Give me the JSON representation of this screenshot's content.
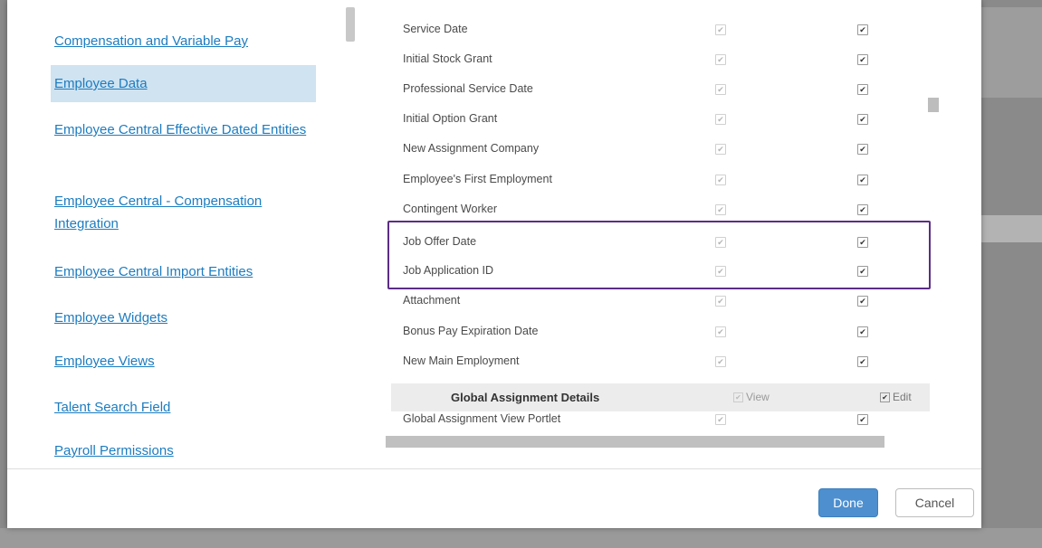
{
  "nav": {
    "items": [
      {
        "label": "Compensation and Variable Pay"
      },
      {
        "label": "Employee Data"
      },
      {
        "label": "Employee Central Effective Dated Entities"
      },
      {
        "label": "Employee Central - Compensation Integration"
      },
      {
        "label": "Employee Central Import Entities"
      },
      {
        "label": "Employee Widgets"
      },
      {
        "label": "Employee Views"
      },
      {
        "label": "Talent Search Field"
      },
      {
        "label": "Payroll Permissions"
      }
    ],
    "selected": "Employee Data"
  },
  "permissions": {
    "rows": [
      {
        "label": "Service Date",
        "view": true,
        "edit": true
      },
      {
        "label": "Initial Stock Grant",
        "view": true,
        "edit": true
      },
      {
        "label": "Professional Service Date",
        "view": true,
        "edit": true
      },
      {
        "label": "Initial Option Grant",
        "view": true,
        "edit": true
      },
      {
        "label": "New Assignment Company",
        "view": true,
        "edit": true
      },
      {
        "label": "Employee's First Employment",
        "view": true,
        "edit": true
      },
      {
        "label": "Contingent Worker",
        "view": true,
        "edit": true
      },
      {
        "label": "Job Offer Date",
        "view": true,
        "edit": true
      },
      {
        "label": "Job Application ID",
        "view": true,
        "edit": true
      },
      {
        "label": "Attachment",
        "view": true,
        "edit": true
      },
      {
        "label": "Bonus Pay Expiration Date",
        "view": true,
        "edit": true
      },
      {
        "label": "New Main Employment",
        "view": true,
        "edit": true
      }
    ],
    "group": {
      "title": "Global Assignment Details",
      "view_label": "View",
      "edit_label": "Edit"
    },
    "group_rows": [
      {
        "label": "Global Assignment View Portlet",
        "view": true,
        "edit": true
      }
    ]
  },
  "check_glyph": "✔",
  "footer": {
    "done_label": "Done",
    "cancel_label": "Cancel"
  },
  "colors": {
    "link": "#1c7cc0",
    "selected_bg": "#cfe3f1",
    "highlight_border": "#5c2d86",
    "done_bg": "#4d8fcf"
  }
}
